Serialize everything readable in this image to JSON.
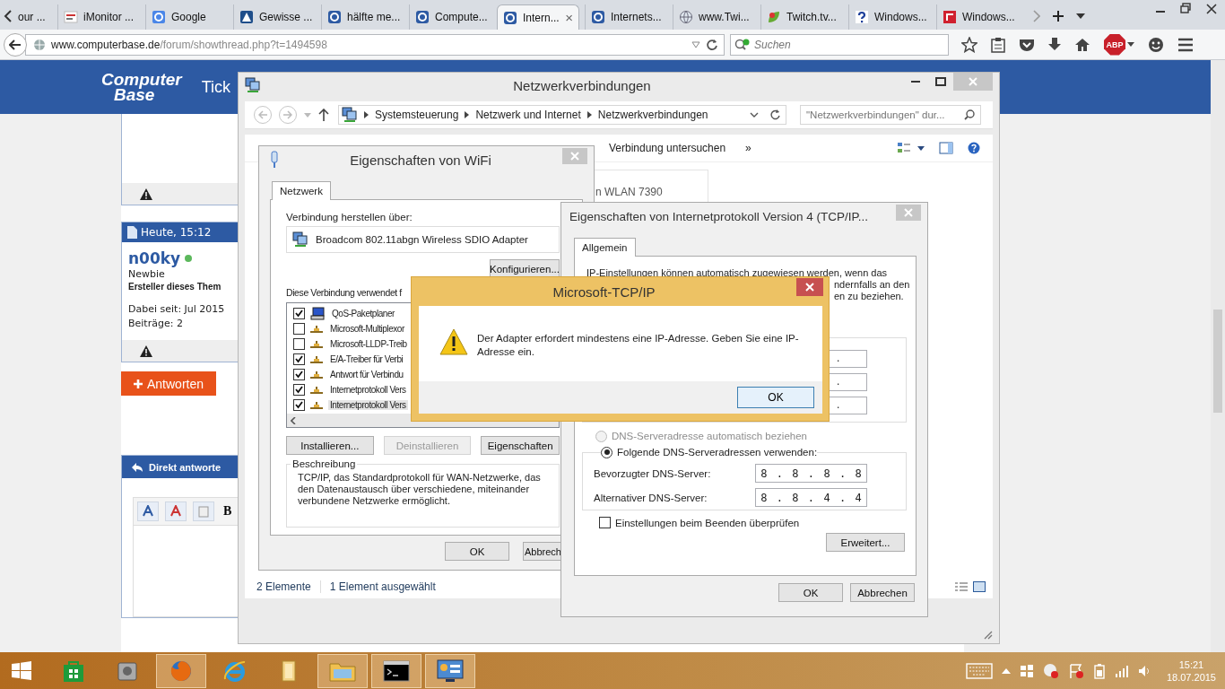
{
  "browser": {
    "tabs": [
      {
        "label": "our ...",
        "selected": false
      },
      {
        "label": "iMonitor ...",
        "kind": "news",
        "selected": false
      },
      {
        "label": "Google",
        "kind": "blue",
        "selected": false
      },
      {
        "label": "Gewisse ...",
        "kind": "triangle",
        "selected": false
      },
      {
        "label": "hälfte me...",
        "kind": "cb",
        "selected": false
      },
      {
        "label": "Compute...",
        "kind": "cb",
        "selected": false
      },
      {
        "label": "Intern...",
        "kind": "cb",
        "selected": true
      },
      {
        "label": "Internets...",
        "kind": "cb",
        "selected": false
      },
      {
        "label": "www.Twi...",
        "kind": "globe",
        "selected": false
      },
      {
        "label": "Twitch.tv...",
        "kind": "leaf",
        "selected": false
      },
      {
        "label": "Windows...",
        "kind": "help",
        "selected": false
      },
      {
        "label": "Windows...",
        "kind": "red",
        "selected": false
      }
    ],
    "close_tab": "×",
    "address": {
      "host": "www.computerbase.de",
      "path": "/forum/showthread.php?t=1494598"
    },
    "search": {
      "placeholder": "Suchen"
    },
    "abp": "ABP"
  },
  "forum": {
    "logo": [
      "Computer",
      "Base"
    ],
    "nav_partial": "Tick",
    "post": {
      "time": "Heute, 15:12",
      "user": "n00ky",
      "online": true,
      "rank": "Newbie",
      "role": "Ersteller dieses Them",
      "joined": "Dabei seit: Jul 2015",
      "posts": "Beiträge: 2"
    },
    "reply_button": "Antworten",
    "quick_reply": {
      "title": "Direkt antworte",
      "bold": "B"
    }
  },
  "explorer": {
    "title": "Netzwerkverbindungen",
    "breadcrumb": [
      "Systemsteuerung",
      "Netzwerk und Internet",
      "Netzwerkverbindungen"
    ],
    "search": {
      "placeholder": "\"Netzwerkverbindungen\" dur..."
    },
    "commands": [
      "Verbindung untersuchen"
    ],
    "more": "»",
    "adapter": "n WLAN 7390",
    "status": [
      "2 Elemente",
      "1 Element ausgewählt"
    ]
  },
  "wifi": {
    "title": "Eigenschaften von WiFi",
    "tabs": [
      {
        "label": "Netzwerk",
        "selected": true
      }
    ],
    "connect_label": "Verbindung herstellen über:",
    "adapter": "Broadcom 802.11abgn Wireless SDIO Adapter",
    "configure": "Konfigurieren...",
    "items_label": "Diese Verbindung verwendet f",
    "items": [
      {
        "kind": "scheduler",
        "label": "QoS-Paketplaner",
        "checked": true,
        "selected": false
      },
      {
        "kind": "protocol",
        "label": "Microsoft-Multiplexor",
        "checked": false,
        "selected": false
      },
      {
        "kind": "protocol",
        "label": "Microsoft-LLDP-Treib",
        "checked": false,
        "selected": false
      },
      {
        "kind": "protocol",
        "label": "E/A-Treiber für Verbi",
        "checked": true,
        "selected": false
      },
      {
        "kind": "protocol",
        "label": "Antwort für Verbindu",
        "checked": true,
        "selected": false
      },
      {
        "kind": "protocol",
        "label": "Internetprotokoll Vers",
        "checked": true,
        "selected": false
      },
      {
        "kind": "protocol",
        "label": "Internetprotokoll Vers",
        "checked": true,
        "selected": true
      }
    ],
    "buttons": [
      {
        "label": "Installieren...",
        "disabled": false
      },
      {
        "label": "Deinstallieren",
        "disabled": true
      },
      {
        "label": "Eigenschaften",
        "disabled": false
      }
    ],
    "description": {
      "title": "Beschreibung",
      "text": "TCP/IP, das Standardprotokoll für WAN-Netzwerke, das den Datenaustausch über verschiedene, miteinander verbundene Netzwerke ermöglicht."
    },
    "footer": [
      "OK",
      "Abbrech"
    ]
  },
  "tcpip": {
    "title": "Eigenschaften von Internetprotokoll Version 4 (TCP/IP...",
    "tabs": [
      {
        "label": "Allgemein",
        "selected": true
      }
    ],
    "intro": [
      "IP-Einstellungen können automatisch zugewiesen werden, wenn das",
      "ndernfalls an den",
      "en zu beziehen."
    ],
    "ip_fields": [
      {
        "separator": "."
      },
      {
        "separator": "."
      },
      {
        "separator": "."
      }
    ],
    "dns_options": [
      {
        "label": "DNS-Serveradresse automatisch beziehen",
        "selected": false,
        "disabled": true
      },
      {
        "label": "Folgende DNS-Serveradressen verwenden:",
        "selected": true,
        "disabled": false
      }
    ],
    "separator": ".",
    "dns": [
      {
        "label": "Bevorzugter DNS-Server:",
        "octets": [
          "8",
          "8",
          "8",
          "8"
        ]
      },
      {
        "label": "Alternativer DNS-Server:",
        "octets": [
          "8",
          "8",
          "4",
          "4"
        ]
      }
    ],
    "validate": {
      "label": "Einstellungen beim Beenden überprüfen",
      "checked": false
    },
    "advanced": "Erweitert...",
    "footer": [
      "OK",
      "Abbrechen"
    ]
  },
  "message": {
    "title": "Microsoft-TCP/IP",
    "text": "Der Adapter erfordert mindestens eine IP-Adresse. Geben Sie eine IP-Adresse ein.",
    "button": "OK"
  },
  "taskbar": {
    "apps": [
      {
        "kind": "store",
        "active": false
      },
      {
        "kind": "tools",
        "active": false
      },
      {
        "kind": "firefox",
        "active": true
      },
      {
        "kind": "ie",
        "active": false
      },
      {
        "kind": "folder",
        "active": false
      },
      {
        "kind": "explorer",
        "active": true
      },
      {
        "kind": "cmd",
        "active": true
      },
      {
        "kind": "control",
        "active": true
      }
    ],
    "time": "15:21",
    "date": "18.07.2015"
  }
}
